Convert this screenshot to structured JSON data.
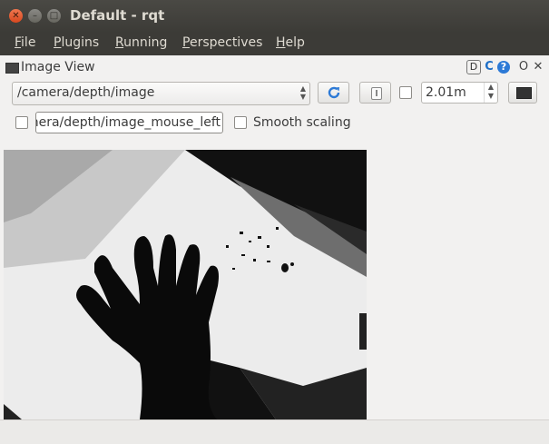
{
  "window": {
    "title": "Default - rqt"
  },
  "menubar": {
    "items": [
      {
        "label": "File",
        "mnemonic": "F",
        "rest": "ile"
      },
      {
        "label": "Plugins",
        "mnemonic": "P",
        "rest": "lugins"
      },
      {
        "label": "Running",
        "mnemonic": "R",
        "rest": "unning"
      },
      {
        "label": "Perspectives",
        "mnemonic": "P",
        "rest": "erspectives"
      },
      {
        "label": "Help",
        "mnemonic": "H",
        "rest": "elp"
      }
    ]
  },
  "plugin": {
    "title": "Image View",
    "dock_buttons": {
      "d": "D",
      "o": "O",
      "x": "✕",
      "c": "C",
      "help": "?"
    }
  },
  "toolbar": {
    "topic": "/camera/depth/image",
    "max_range": "2.01m",
    "mouse_topic": "nera/depth/image_mouse_left",
    "smooth_scaling_label": "Smooth scaling",
    "dynamic_range_checked": false,
    "mouse_publish_checked": false,
    "smooth_scaling_checked": false
  },
  "icons": {
    "refresh": "refresh-icon",
    "zoom": "zoom-1-icon",
    "save": "save-image-icon",
    "plugin": "image-view-plugin-icon"
  },
  "colors": {
    "titlebar": "#3c3b37",
    "close": "#e95420",
    "accent": "#2d7ad6"
  }
}
